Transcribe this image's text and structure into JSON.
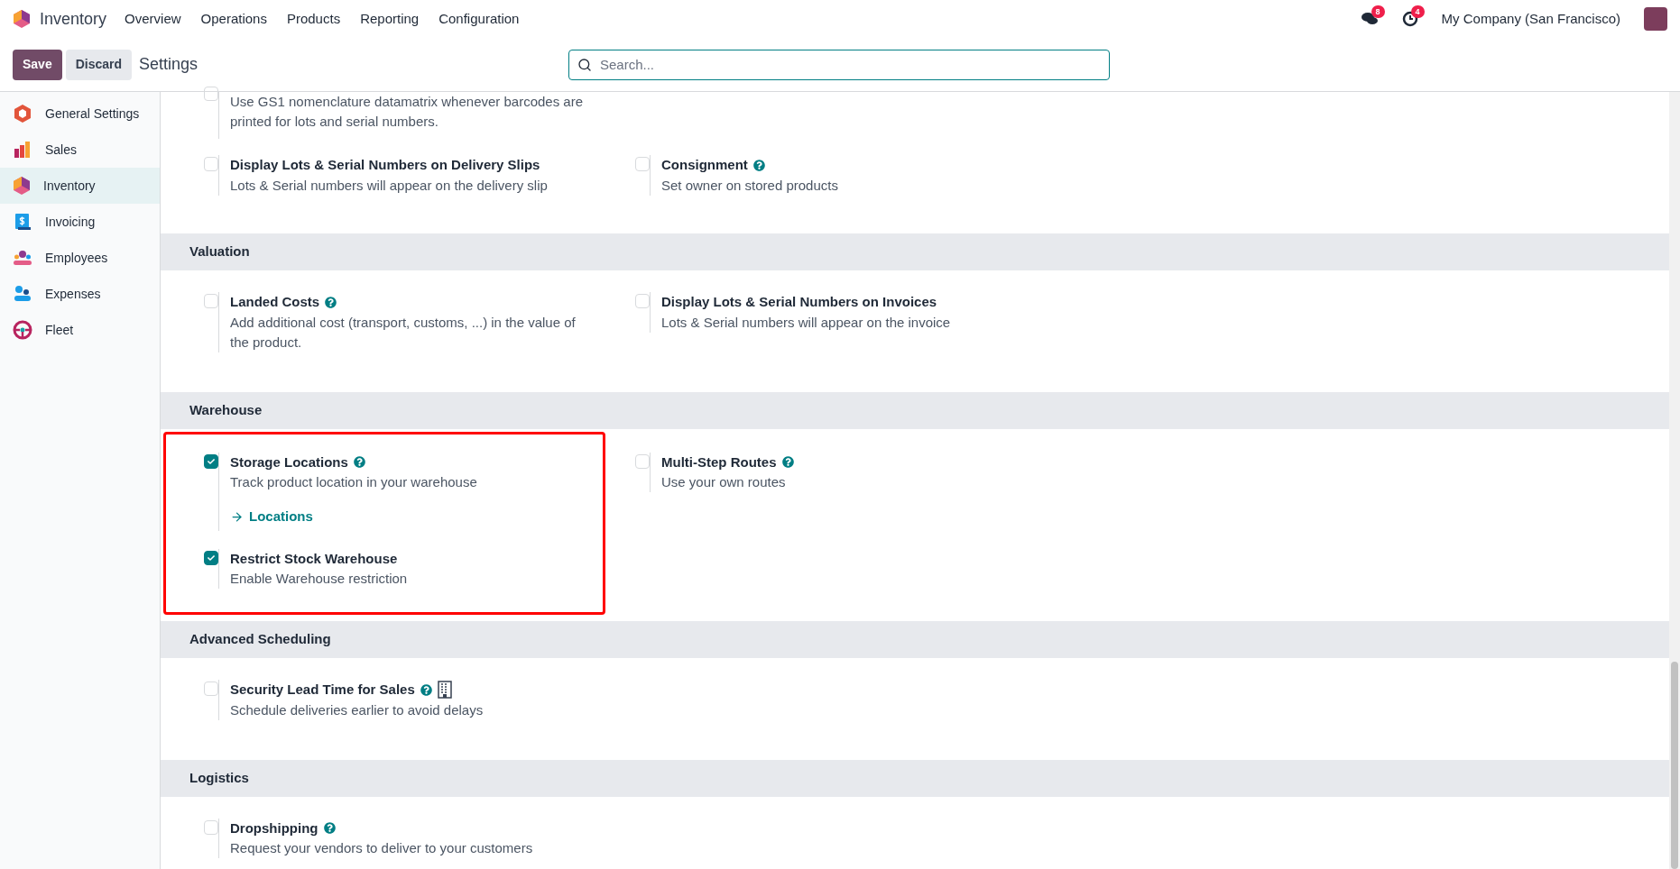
{
  "navbar": {
    "app": "Inventory",
    "menu": [
      "Overview",
      "Operations",
      "Products",
      "Reporting",
      "Configuration"
    ],
    "messages_count": "8",
    "activities_count": "4",
    "company": "My Company (San Francisco)"
  },
  "control_panel": {
    "buttons": [
      {
        "label": "Save",
        "kind": "primary"
      },
      {
        "label": "Discard",
        "kind": "secondary"
      }
    ],
    "title": "Settings",
    "search": {
      "placeholder": "Search..."
    }
  },
  "sidebar": {
    "items": [
      {
        "label": "General Settings",
        "kind": "general",
        "selected": false
      },
      {
        "label": "Sales",
        "kind": "sales",
        "selected": false
      },
      {
        "label": "Inventory",
        "kind": "inventory",
        "selected": true
      },
      {
        "label": "Invoicing",
        "kind": "invoicing",
        "selected": false
      },
      {
        "label": "Employees",
        "kind": "employees",
        "selected": false
      },
      {
        "label": "Expenses",
        "kind": "expenses",
        "selected": false
      },
      {
        "label": "Fleet",
        "kind": "fleet",
        "selected": false
      }
    ]
  },
  "sections": [
    {
      "partial": {
        "description": "Use GS1 nomenclature datamatrix whenever barcodes are printed for lots and serial numbers.",
        "checked": false
      },
      "columns": [
        [
          {
            "label": "Display Lots & Serial Numbers on Delivery Slips",
            "description": "Lots & Serial numbers will appear on the delivery slip",
            "checked": false,
            "help": false
          }
        ],
        [
          {
            "label": "Consignment",
            "description": "Set owner on stored products",
            "checked": false,
            "help": true
          }
        ]
      ],
      "highlighted": false
    },
    {
      "title": "Valuation",
      "columns": [
        [
          {
            "label": "Landed Costs",
            "description": "Add additional cost (transport, customs, ...) in the value of the product.",
            "checked": false,
            "help": true
          }
        ],
        [
          {
            "label": "Display Lots & Serial Numbers on Invoices",
            "description": "Lots & Serial numbers will appear on the invoice",
            "checked": false,
            "help": false
          }
        ]
      ],
      "highlighted": false
    },
    {
      "title": "Warehouse",
      "columns": [
        [
          {
            "label": "Storage Locations",
            "description": "Track product location in your warehouse",
            "checked": true,
            "help": true,
            "link": "Locations"
          },
          {
            "label": "Restrict Stock Warehouse",
            "description": "Enable Warehouse restriction",
            "checked": true,
            "help": false
          }
        ],
        [
          {
            "label": "Multi-Step Routes",
            "description": "Use your own routes",
            "checked": false,
            "help": true
          }
        ]
      ],
      "highlighted": true
    },
    {
      "title": "Advanced Scheduling",
      "columns": [
        [
          {
            "label": "Security Lead Time for Sales",
            "description": "Schedule deliveries earlier to avoid delays",
            "checked": false,
            "help": true,
            "company_specific": true
          }
        ],
        []
      ],
      "highlighted": false
    },
    {
      "title": "Logistics",
      "columns": [
        [
          {
            "label": "Dropshipping",
            "description": "Request your vendors to deliver to your customers",
            "checked": false,
            "help": true
          }
        ],
        []
      ],
      "highlighted": false
    }
  ]
}
